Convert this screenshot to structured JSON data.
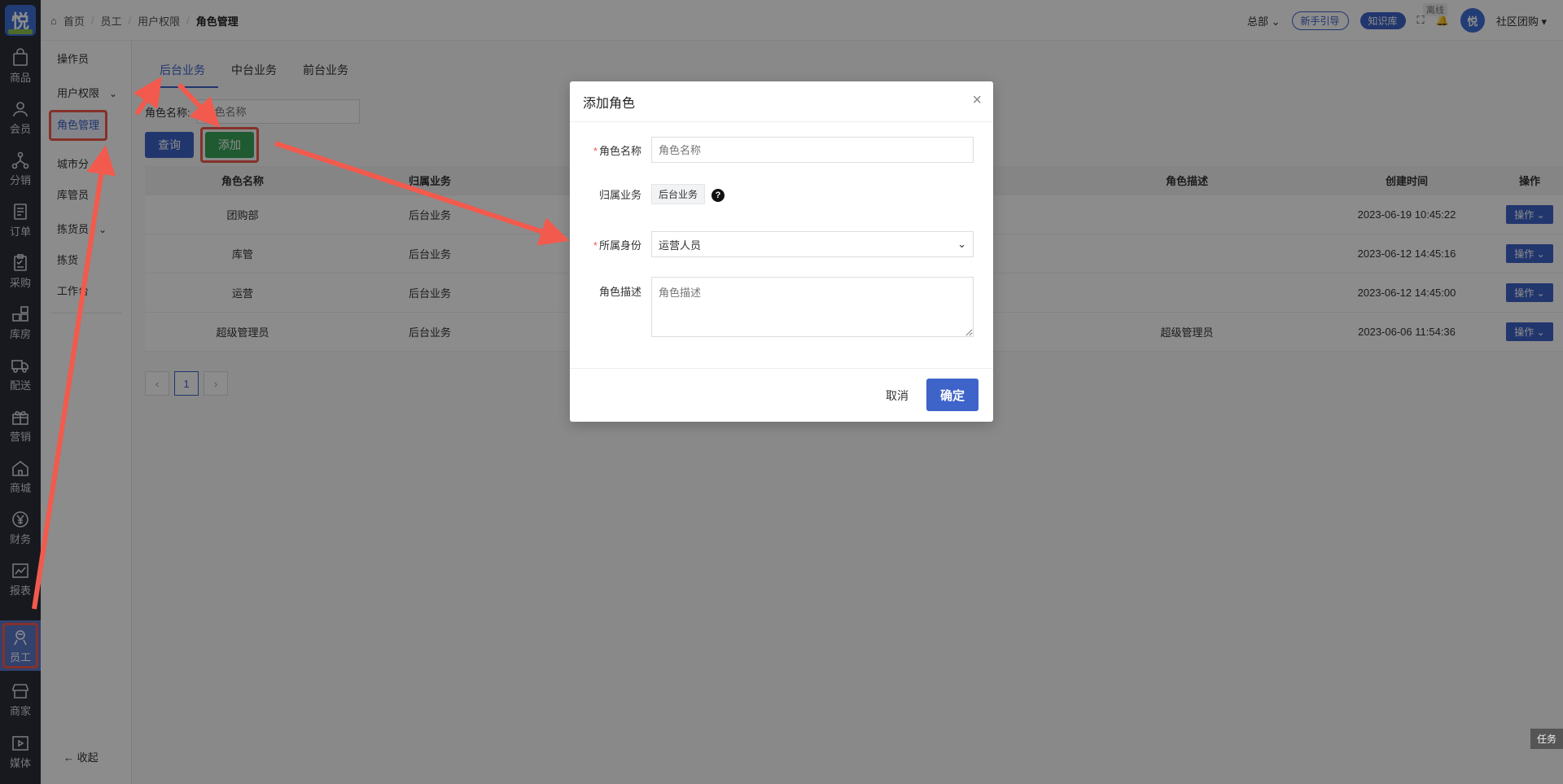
{
  "rail": {
    "logo": "悦",
    "items": [
      {
        "label": "商品",
        "icon": "bag-icon"
      },
      {
        "label": "会员",
        "icon": "person-icon"
      },
      {
        "label": "分销",
        "icon": "network-icon"
      },
      {
        "label": "订单",
        "icon": "document-icon"
      },
      {
        "label": "采购",
        "icon": "clipboard-icon"
      },
      {
        "label": "库房",
        "icon": "grid-icon"
      },
      {
        "label": "配送",
        "icon": "truck-icon"
      },
      {
        "label": "营销",
        "icon": "gift-icon"
      },
      {
        "label": "商城",
        "icon": "home-icon"
      },
      {
        "label": "财务",
        "icon": "yen-icon"
      },
      {
        "label": "报表",
        "icon": "chart-icon"
      },
      {
        "label": "员工",
        "icon": "staff-icon"
      },
      {
        "label": "商家",
        "icon": "store-icon"
      },
      {
        "label": "媒体",
        "icon": "play-icon"
      }
    ]
  },
  "side": {
    "items": [
      "操作员",
      "用户权限",
      "角色管理",
      "城市分",
      "库管员",
      "拣货员",
      "拣货",
      "工作台"
    ],
    "collapse": "收起"
  },
  "breadcrumb": {
    "home": "首页",
    "level1": "员工",
    "level2": "用户权限",
    "current": "角色管理"
  },
  "topright": {
    "org": "总部",
    "guide": "新手引导",
    "kb": "知识库",
    "offline": "离线",
    "user": "社区团购"
  },
  "tabs": [
    "后台业务",
    "中台业务",
    "前台业务"
  ],
  "filter": {
    "label": "角色名称:",
    "placeholder": "角色名称"
  },
  "buttons": {
    "query": "查询",
    "add": "添加"
  },
  "table": {
    "headers": [
      "角色名称",
      "归属业务",
      "角色描述",
      "创建时间",
      "操作"
    ],
    "rows": [
      {
        "name": "团购部",
        "biz": "后台业务",
        "desc": "",
        "time": "2023-06-19 10:45:22",
        "op": "操作"
      },
      {
        "name": "库管",
        "biz": "后台业务",
        "desc": "",
        "time": "2023-06-12 14:45:16",
        "op": "操作"
      },
      {
        "name": "运营",
        "biz": "后台业务",
        "desc": "",
        "time": "2023-06-12 14:45:00",
        "op": "操作"
      },
      {
        "name": "超级管理员",
        "biz": "后台业务",
        "desc": "超级管理员",
        "time": "2023-06-06 11:54:36",
        "op": "操作"
      }
    ]
  },
  "pager": {
    "page": "1"
  },
  "task": "任务",
  "modal": {
    "title": "添加角色",
    "name_label": "角色名称",
    "name_placeholder": "角色名称",
    "biz_label": "归属业务",
    "biz_value": "后台业务",
    "identity_label": "所属身份",
    "identity_value": "运营人员",
    "desc_label": "角色描述",
    "desc_placeholder": "角色描述",
    "cancel": "取消",
    "ok": "确定"
  },
  "colors": {
    "primary": "#3e63c9",
    "add": "#3aa55a",
    "annotation": "#f25a4d",
    "rail": "#2b2f3a"
  }
}
